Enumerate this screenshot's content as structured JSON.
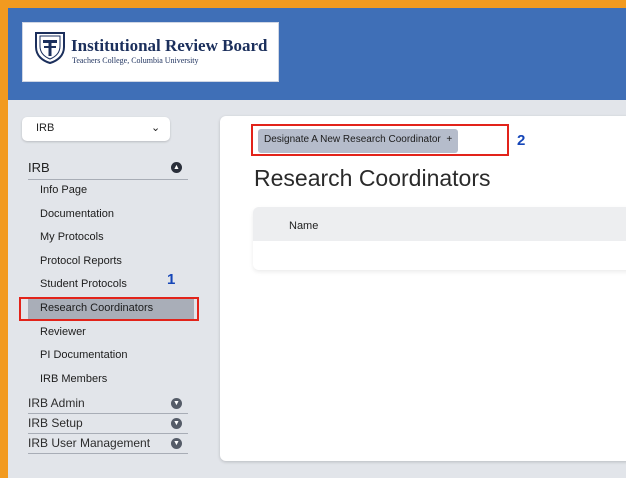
{
  "header": {
    "logo_title": "Institutional Review Board",
    "logo_subtitle": "Teachers College, Columbia University"
  },
  "sidebar": {
    "module_select": {
      "value": "IRB"
    },
    "section": {
      "label": "IRB"
    },
    "items": [
      {
        "label": "Info Page"
      },
      {
        "label": "Documentation"
      },
      {
        "label": "My Protocols"
      },
      {
        "label": "Protocol Reports"
      },
      {
        "label": "Student Protocols"
      },
      {
        "label": "Research Coordinators",
        "active": true
      },
      {
        "label": "Reviewer"
      },
      {
        "label": "PI Documentation"
      },
      {
        "label": "IRB Members"
      }
    ],
    "collapsed_sections": [
      {
        "label": "IRB Admin"
      },
      {
        "label": "IRB Setup"
      },
      {
        "label": "IRB User Management"
      }
    ]
  },
  "main": {
    "designate_button": {
      "label": "Designate A New Research Coordinator",
      "icon": "+"
    },
    "page_title": "Research Coordinators",
    "table": {
      "columns": [
        "Name"
      ]
    }
  },
  "annotations": {
    "marker_1": "1",
    "marker_2": "2"
  },
  "colors": {
    "header_bg": "#3f6fb7",
    "outer_border": "#f29a1f",
    "callout": "#e2231a",
    "marker_text": "#1546b8",
    "active_item": "#a9aeb8"
  }
}
